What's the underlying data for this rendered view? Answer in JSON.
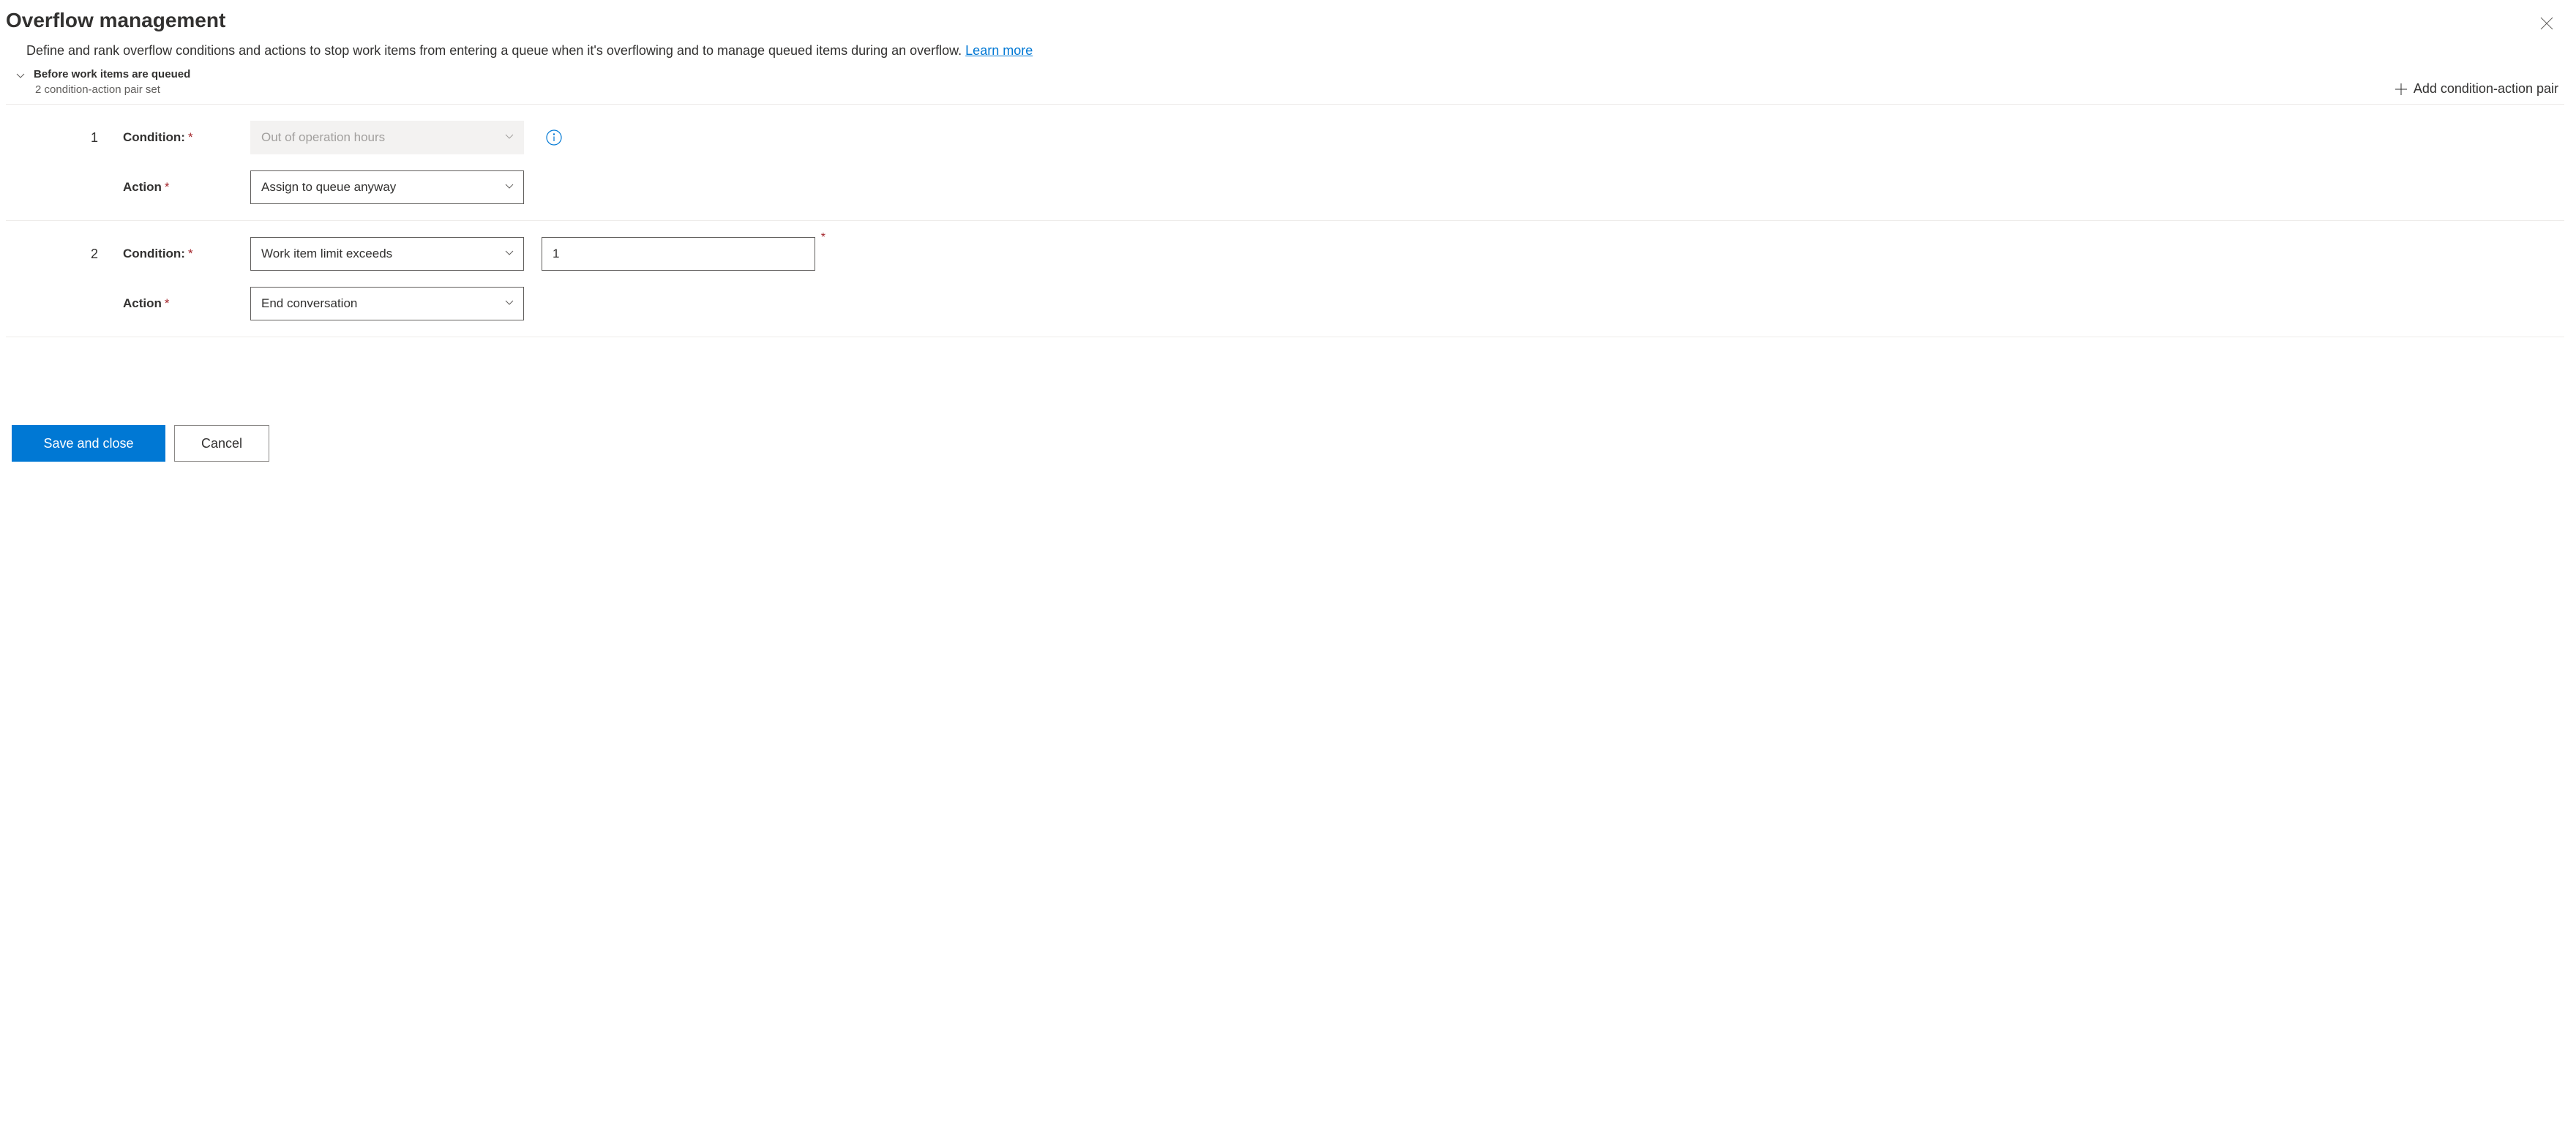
{
  "header": {
    "title": "Overflow management",
    "description": "Define and rank overflow conditions and actions to stop work items from entering a queue when it's overflowing and to manage queued items during an overflow. ",
    "learn_more": "Learn more"
  },
  "section": {
    "title": "Before work items are queued",
    "subtitle": "2 condition-action pair set",
    "add_label": "Add condition-action pair"
  },
  "labels": {
    "condition": "Condition:",
    "action": "Action"
  },
  "pairs": [
    {
      "index": "1",
      "condition_value": "Out of operation hours",
      "condition_disabled": true,
      "show_info": true,
      "action_value": "Assign to queue anyway",
      "extra_input": null
    },
    {
      "index": "2",
      "condition_value": "Work item limit exceeds",
      "condition_disabled": false,
      "show_info": false,
      "action_value": "End conversation",
      "extra_input": "1"
    }
  ],
  "footer": {
    "save": "Save and close",
    "cancel": "Cancel"
  }
}
